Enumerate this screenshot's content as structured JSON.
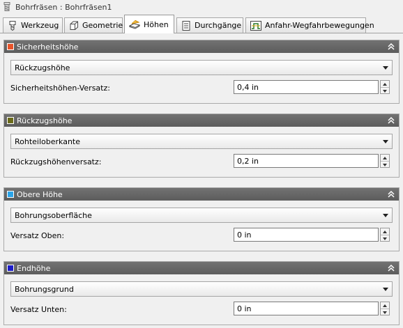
{
  "window": {
    "title": "Bohrfräsen : Bohrfräsen1"
  },
  "tabs": [
    {
      "label": "Werkzeug",
      "active": false
    },
    {
      "label": "Geometrie",
      "active": false
    },
    {
      "label": "Höhen",
      "active": true
    },
    {
      "label": "Durchgänge",
      "active": false
    },
    {
      "label": "Anfahr-Wegfahrbewegungen",
      "active": false
    }
  ],
  "sections": [
    {
      "title": "Sicherheitshöhe",
      "color": "#e8542a",
      "dropdown_value": "Rückzugshöhe",
      "field_label": "Sicherheitshöhen-Versatz:",
      "field_value": "0,4 in"
    },
    {
      "title": "Rückzugshöhe",
      "color": "#6b6b1a",
      "dropdown_value": "Rohteiloberkante",
      "field_label": "Rückzugshöhenversatz:",
      "field_value": "0,2 in"
    },
    {
      "title": "Obere Höhe",
      "color": "#2ba4e8",
      "dropdown_value": "Bohrungsoberfläche",
      "field_label": "Versatz Oben:",
      "field_value": "0 in"
    },
    {
      "title": "Endhöhe",
      "color": "#1c1cc8",
      "dropdown_value": "Bohrungsgrund",
      "field_label": "Versatz Unten:",
      "field_value": "0 in"
    }
  ]
}
